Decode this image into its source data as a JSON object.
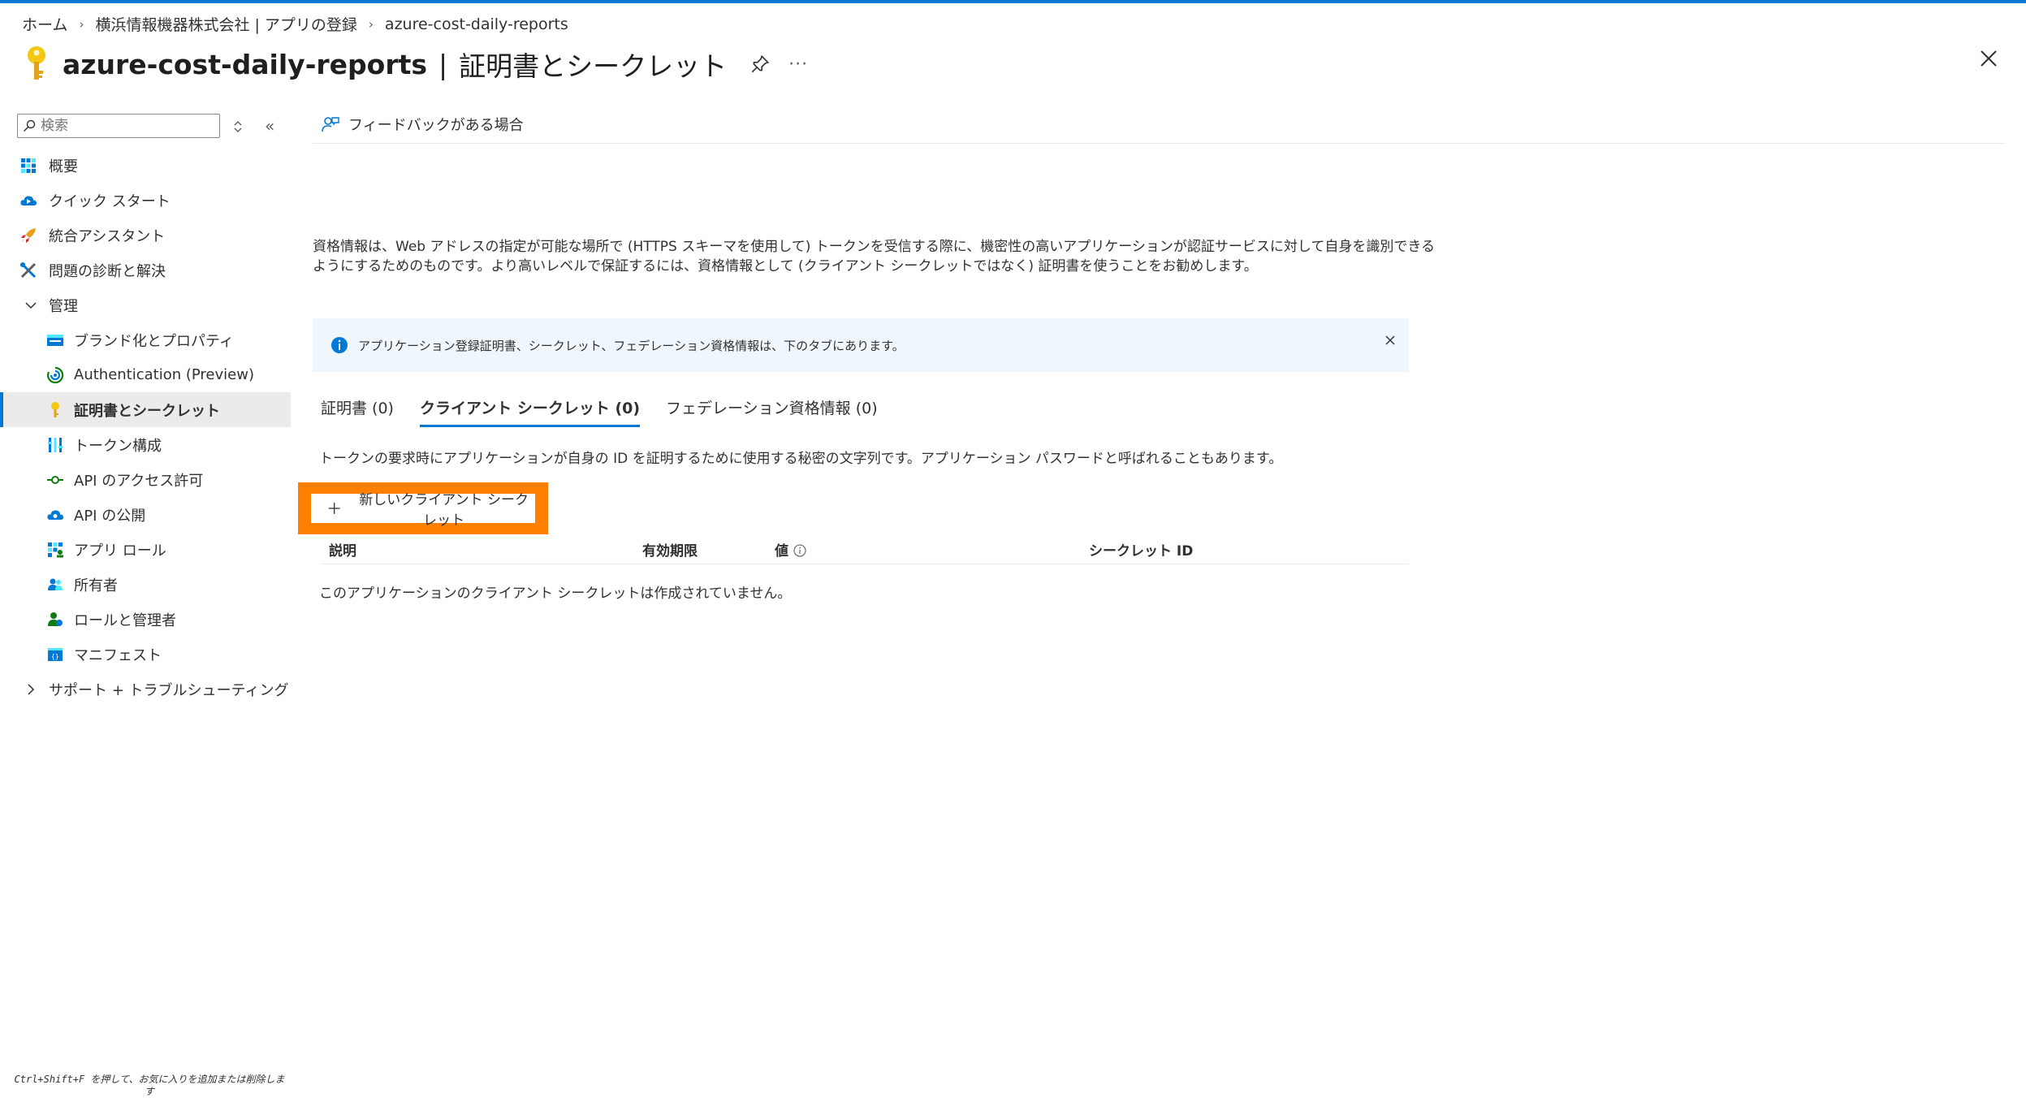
{
  "breadcrumb": {
    "items": [
      "ホーム",
      "横浜情報機器株式会社 | アプリの登録",
      "azure-cost-daily-reports"
    ]
  },
  "header": {
    "title": "azure-cost-daily-reports",
    "separator": "|",
    "subtitle": "証明書とシークレット",
    "more": "···"
  },
  "sidebar": {
    "search_placeholder": "検索",
    "items": [
      {
        "label": "概要",
        "icon": "overview-grid-icon"
      },
      {
        "label": "クイック スタート",
        "icon": "cloud-quickstart-icon"
      },
      {
        "label": "統合アシスタント",
        "icon": "rocket-icon"
      },
      {
        "label": "問題の診断と解決",
        "icon": "wrench-icon"
      },
      {
        "label": "管理",
        "icon": "chevron-down-icon"
      },
      {
        "label": "ブランド化とプロパティ",
        "icon": "branding-card-icon"
      },
      {
        "label": "Authentication (Preview)",
        "icon": "authentication-icon"
      },
      {
        "label": "証明書とシークレット",
        "icon": "key-icon"
      },
      {
        "label": "トークン構成",
        "icon": "token-bars-icon"
      },
      {
        "label": "API のアクセス許可",
        "icon": "api-permission-icon"
      },
      {
        "label": "API の公開",
        "icon": "cloud-api-icon"
      },
      {
        "label": "アプリ ロール",
        "icon": "app-roles-grid-icon"
      },
      {
        "label": "所有者",
        "icon": "owners-people-icon"
      },
      {
        "label": "ロールと管理者",
        "icon": "roles-admin-icon"
      },
      {
        "label": "マニフェスト",
        "icon": "manifest-icon"
      },
      {
        "label": "サポート + トラブルシューティング",
        "icon": "chevron-right-icon"
      }
    ],
    "hint": "Ctrl+Shift+F を押して、お気に入りを追加または削除します"
  },
  "toolbar": {
    "feedback_label": "フィードバックがある場合"
  },
  "main": {
    "description": "資格情報は、Web アドレスの指定が可能な場所で (HTTPS スキーマを使用して) トークンを受信する際に、機密性の高いアプリケーションが認証サービスに対して自身を識別できるようにするためのものです。より高いレベルで保証するには、資格情報として (クライアント シークレットではなく) 証明書を使うことをお勧めします。",
    "info_text": "アプリケーション登録証明書、シークレット、フェデレーション資格情報は、下のタブにあります。",
    "tabs": [
      "証明書 (0)",
      "クライアント シークレット (0)",
      "フェデレーション資格情報 (0)"
    ],
    "active_tab": "クライアント シークレット (0)",
    "tab_description": "トークンの要求時にアプリケーションが自身の ID を証明するために使用する秘密の文字列です。アプリケーション パスワードと呼ばれることもあります。",
    "new_secret_label": "新しいクライアント シークレット",
    "highlight_color": "#ff8000",
    "table_headers": [
      "説明",
      "有効期限",
      "値",
      "シークレット ID"
    ],
    "empty_message": "このアプリケーションのクライアント シークレットは作成されていません。"
  },
  "colors": {
    "accent": "#0078d4",
    "info_background": "#eff6fc",
    "active_nav_background": "#edebe9"
  }
}
